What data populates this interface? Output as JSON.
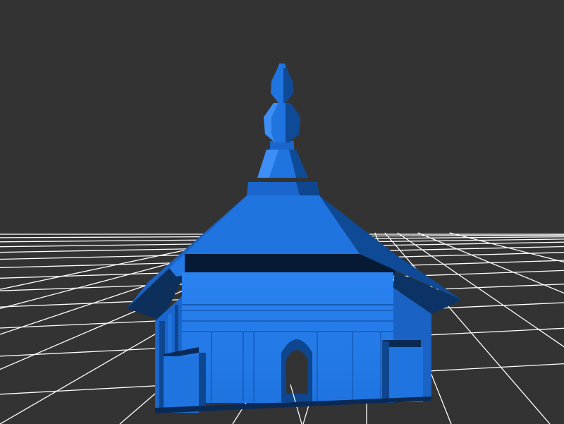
{
  "scene": {
    "background_color": "#333333",
    "grid_color": "#ffffff",
    "model_color": "#1f74e0",
    "model_shadow_color": "#0a2a55",
    "model_highlight_color": "#3d8ef5",
    "model_icon": "pagoda-temple-model"
  }
}
